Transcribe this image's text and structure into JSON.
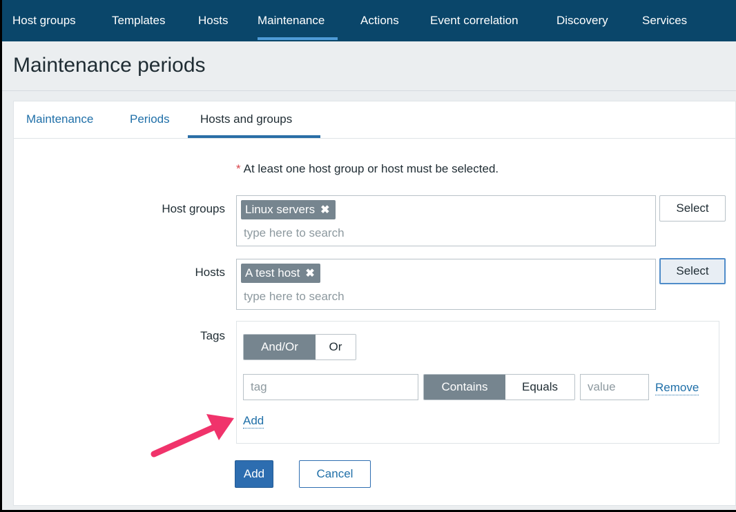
{
  "topnav": {
    "items": [
      {
        "label": "Host groups",
        "active": false
      },
      {
        "label": "Templates",
        "active": false
      },
      {
        "label": "Hosts",
        "active": false
      },
      {
        "label": "Maintenance",
        "active": true
      },
      {
        "label": "Actions",
        "active": false
      },
      {
        "label": "Event correlation",
        "active": false
      },
      {
        "label": "Discovery",
        "active": false
      },
      {
        "label": "Services",
        "active": false
      }
    ]
  },
  "page": {
    "title": "Maintenance periods"
  },
  "tabs": [
    {
      "label": "Maintenance",
      "active": false
    },
    {
      "label": "Periods",
      "active": false
    },
    {
      "label": "Hosts and groups",
      "active": true
    }
  ],
  "form": {
    "required_star": "*",
    "required_note": "At least one host group or host must be selected.",
    "host_groups": {
      "label": "Host groups",
      "chips": [
        "Linux servers"
      ],
      "placeholder": "type here to search",
      "select_label": "Select"
    },
    "hosts": {
      "label": "Hosts",
      "chips": [
        "A test host"
      ],
      "placeholder": "type here to search",
      "select_label": "Select"
    },
    "tags": {
      "label": "Tags",
      "evaltype": {
        "options": [
          "And/Or",
          "Or"
        ],
        "selected": "And/Or"
      },
      "row": {
        "tag_placeholder": "tag",
        "operator": {
          "options": [
            "Contains",
            "Equals"
          ],
          "selected": "Contains"
        },
        "value_placeholder": "value",
        "remove_label": "Remove"
      },
      "add_label": "Add"
    },
    "submit_label": "Add",
    "cancel_label": "Cancel"
  },
  "colors": {
    "nav_bg": "#0a466a",
    "nav_active_underline": "#4e9cd8",
    "link": "#1f6fa8",
    "primary_button": "#2d6db0",
    "chip_bg": "#76858f",
    "required_star": "#d9434a",
    "annotation_arrow": "#f0336b"
  }
}
